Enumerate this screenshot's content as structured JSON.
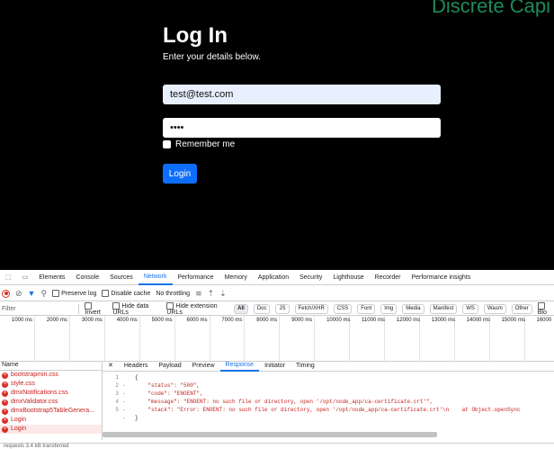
{
  "app": {
    "brand": "Discrete Capi",
    "title": "Log In",
    "subtitle": "Enter your details below.",
    "email_value": "test@test.com",
    "password_value": "••••",
    "remember_label": "Remember me",
    "login_label": "Login"
  },
  "devtools": {
    "tabs": [
      "Elements",
      "Console",
      "Sources",
      "Network",
      "Performance",
      "Memory",
      "Application",
      "Security",
      "Lighthouse",
      "Recorder",
      "Performance insights"
    ],
    "active_tab": "Network",
    "toolbar": {
      "preserve_log": "Preserve log",
      "disable_cache": "Disable cache",
      "throttling": "No throttling"
    },
    "filter": {
      "placeholder": "Filter",
      "invert": "Invert",
      "hide_data_urls": "Hide data URLs",
      "hide_extension_urls": "Hide extension URLs",
      "chips": [
        "All",
        "Doc",
        "JS",
        "Fetch/XHR",
        "CSS",
        "Font",
        "Img",
        "Media",
        "Manifest",
        "WS",
        "Wasm",
        "Other",
        "Blo"
      ]
    },
    "timeline_ticks": [
      "1000 ms",
      "2000 ms",
      "3000 ms",
      "4000 ms",
      "5000 ms",
      "6000 ms",
      "7000 ms",
      "8000 ms",
      "9000 ms",
      "10000 ms",
      "11000 ms",
      "12000 ms",
      "13000 ms",
      "14000 ms",
      "15000 ms",
      "16000"
    ],
    "name_header": "Name",
    "requests": [
      "bootstrapmin.css",
      "style.css",
      "dmxNotifications.css",
      "dmxValidator.css",
      "dmxBootstrap5TableGenera...",
      "Login",
      "Login"
    ],
    "detail_tabs": [
      "Headers",
      "Payload",
      "Preview",
      "Response",
      "Initiator",
      "Timing"
    ],
    "active_detail_tab": "Response",
    "response_lines": [
      {
        "ln": "1",
        "g": "",
        "text": "{"
      },
      {
        "ln": "2",
        "g": "-",
        "text": "    \"status\": \"500\","
      },
      {
        "ln": "3",
        "g": "-",
        "text": "    \"code\": \"ENOENT\","
      },
      {
        "ln": "4",
        "g": "-",
        "text": "    \"message\": \"ENOENT: no such file or directory, open '/opt/node_app/ca-certificate.crt'\","
      },
      {
        "ln": "5",
        "g": "-",
        "text": "    \"stack\": \"Error: ENOENT: no such file or directory, open '/opt/node_app/ca-certificate.crt'\\n    at Object.openSync"
      },
      {
        "ln": "",
        "g": "-",
        "text": "}"
      }
    ],
    "status_text": "requests  3.4 kB transferred"
  }
}
